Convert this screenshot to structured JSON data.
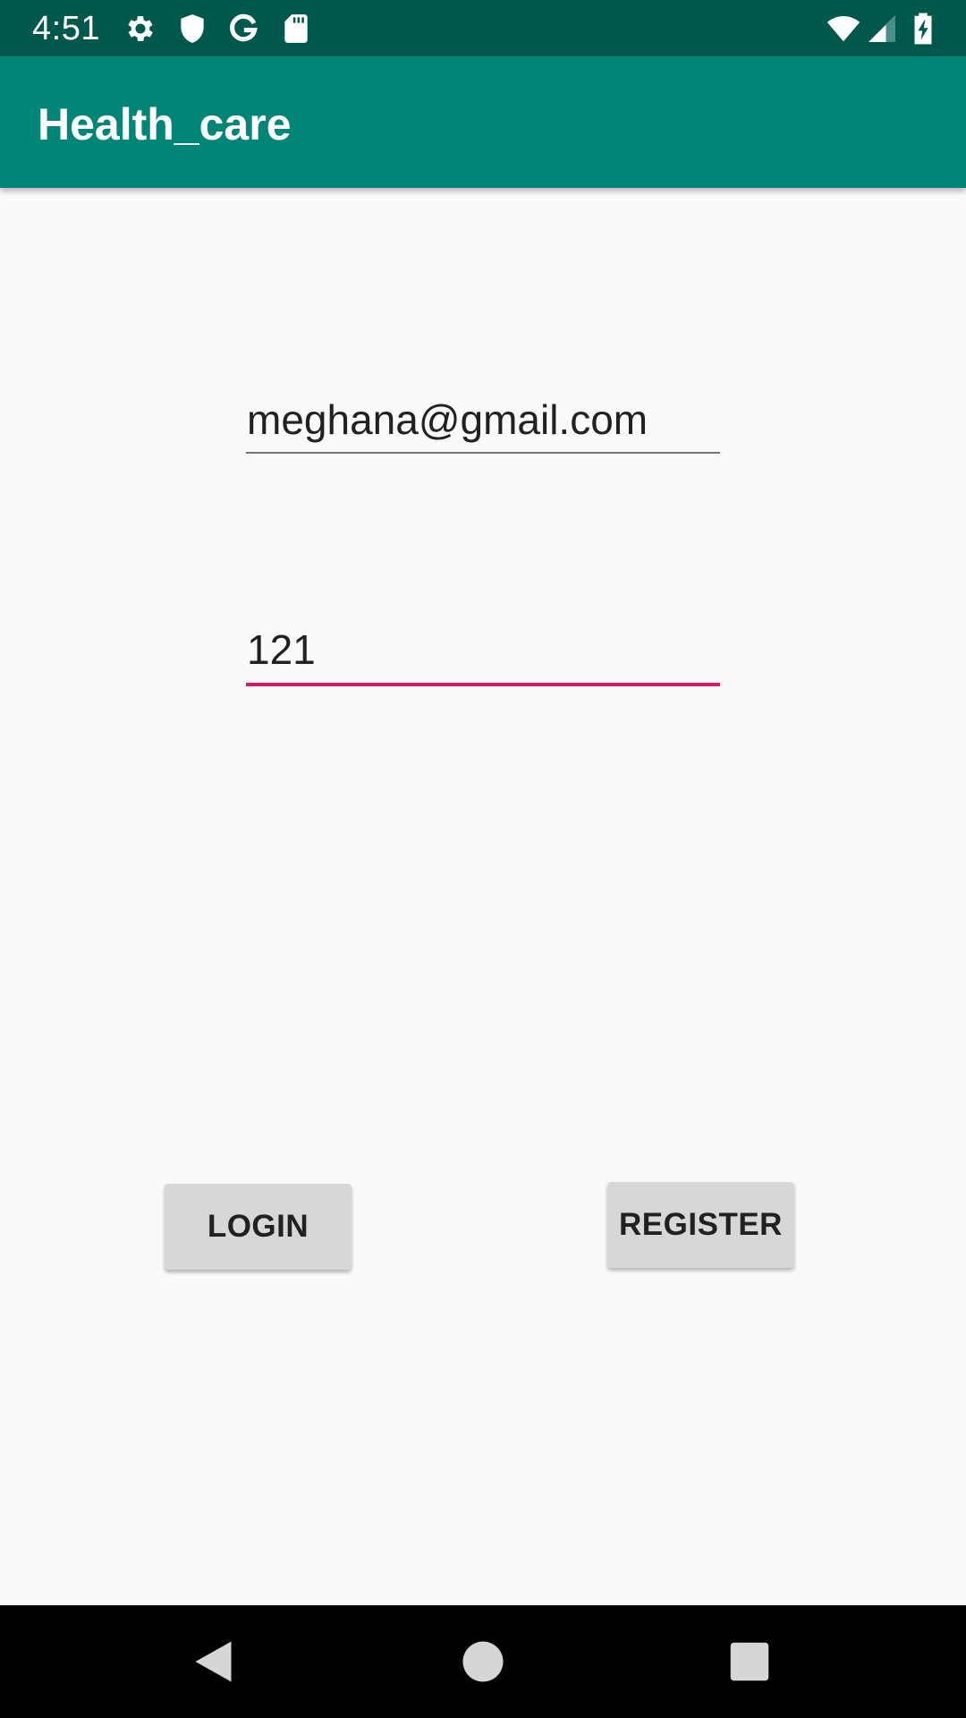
{
  "status_bar": {
    "time": "4:51",
    "icons": [
      "settings-icon",
      "shield-icon",
      "google-icon",
      "sd-card-icon",
      "wifi-icon",
      "signal-icon",
      "battery-charging-icon"
    ]
  },
  "app_bar": {
    "title": "Health_care"
  },
  "form": {
    "email_value": "meghana@gmail.com",
    "password_value": "121"
  },
  "buttons": {
    "login_label": "LOGIN",
    "register_label": "REGISTER"
  },
  "nav_bar": {
    "icons": [
      "back-icon",
      "home-icon",
      "recents-icon"
    ]
  },
  "colors": {
    "status_bar": "#00574b",
    "app_bar": "#008577",
    "accent": "#d81b60",
    "background": "#fafafa",
    "button": "#d6d7d7"
  }
}
